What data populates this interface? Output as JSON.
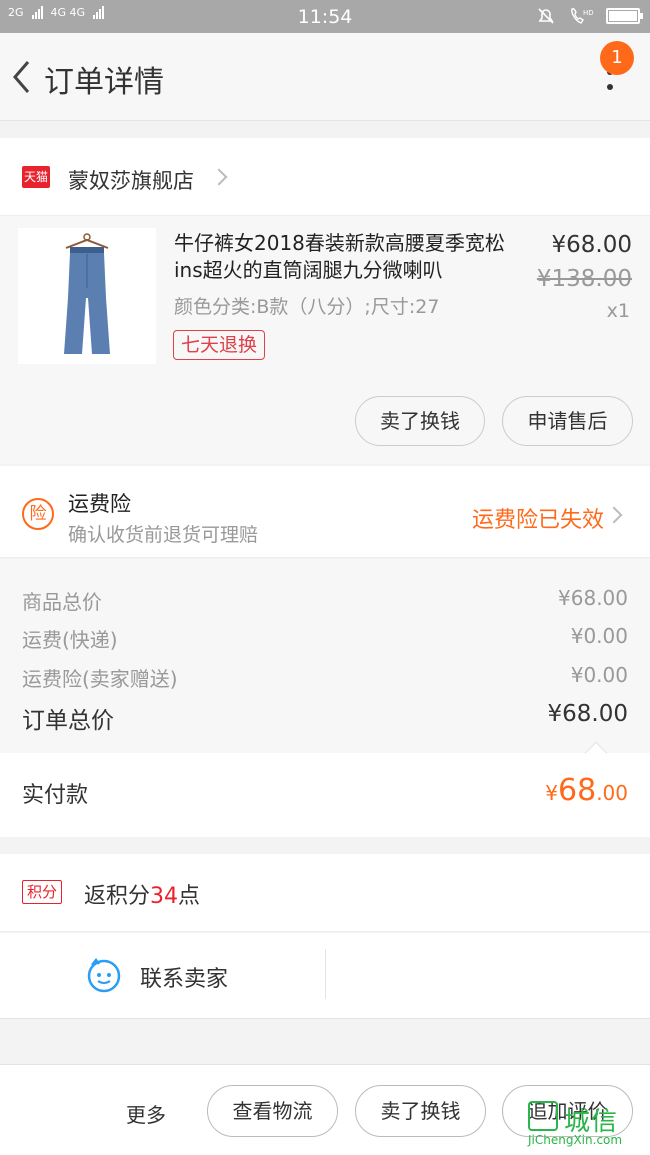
{
  "status_bar": {
    "signal_left": "2G",
    "signal_right": "4G 4G",
    "time": "11:54",
    "hd_label": "HD",
    "battery_level": 1.0
  },
  "header": {
    "title": "订单详情",
    "notification_count": "1"
  },
  "shop": {
    "badge": "天猫",
    "name": "蒙奴莎旗舰店"
  },
  "product": {
    "title": "牛仔裤女2018春装新款高腰夏季宽松ins超火的直筒阔腿九分微喇叭",
    "sku": "颜色分类:B款（八分）;尺寸:27",
    "tag": "七天退换",
    "price": "¥68.00",
    "original_price": "¥138.00",
    "quantity": "x1",
    "actions": [
      "卖了换钱",
      "申请售后"
    ]
  },
  "insurance": {
    "icon_text": "险",
    "title": "运费险",
    "subtitle": "确认收货前退货可理赔",
    "status": "运费险已失效"
  },
  "summary": {
    "rows": [
      {
        "label": "商品总价",
        "value": "¥68.00"
      },
      {
        "label": "运费(快递)",
        "value": "¥0.00"
      },
      {
        "label": "运费险(卖家赠送)",
        "value": "¥0.00"
      }
    ],
    "total_label": "订单总价",
    "total_value": "¥68.00",
    "paid_label": "实付款",
    "paid_currency": "¥",
    "paid_int": "68",
    "paid_dec": ".00"
  },
  "points": {
    "tag": "积分",
    "prefix": "返积分",
    "number": "34",
    "suffix": "点"
  },
  "contact": {
    "label": "联系卖家"
  },
  "bottom_bar": {
    "more": "更多",
    "buttons": [
      "查看物流",
      "卖了换钱",
      "追加评价"
    ]
  },
  "watermark": {
    "text": "城信",
    "domain": "JiChengXin.com"
  },
  "colors": {
    "accent_orange": "#ff6a1a",
    "tmall_red": "#e8232d",
    "status_bar": "#a8a8a8"
  }
}
